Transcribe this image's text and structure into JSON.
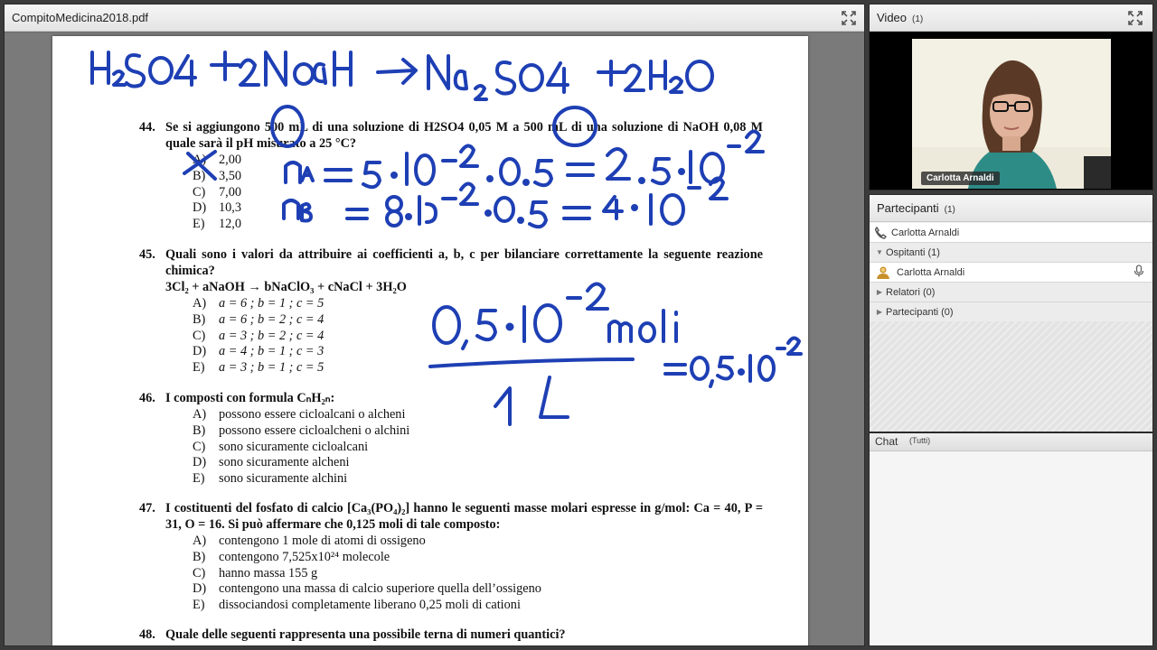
{
  "document_pod": {
    "title": "CompitoMedicina2018.pdf",
    "questions": [
      {
        "num": "44.",
        "text": "Se si aggiungono 500 mL di una soluzione di H2SO4 0,05 M a 500 mL di una soluzione di NaOH 0,08 M quale sarà il pH misurato a 25 °C?",
        "options": [
          {
            "letter": "A)",
            "text": "2,00"
          },
          {
            "letter": "B)",
            "text": "3,50"
          },
          {
            "letter": "C)",
            "text": "7,00"
          },
          {
            "letter": "D)",
            "text": "10,3"
          },
          {
            "letter": "E)",
            "text": "12,0"
          }
        ]
      },
      {
        "num": "45.",
        "text": "Quali sono i valori da attribuire ai coefficienti a, b, c per bilanciare correttamente la seguente reazione chimica?",
        "formula": "3Cl₂ + aNaOH → bNaClO₃ + cNaCl + 3H₂O",
        "options": [
          {
            "letter": "A)",
            "text": "a = 6 ; b = 1 ; c = 5"
          },
          {
            "letter": "B)",
            "text": "a = 6 ; b = 2 ; c = 4"
          },
          {
            "letter": "C)",
            "text": "a = 3 ; b = 2 ; c = 4"
          },
          {
            "letter": "D)",
            "text": "a = 4 ; b = 1 ; c = 3"
          },
          {
            "letter": "E)",
            "text": "a = 3 ; b = 1 ; c = 5"
          }
        ]
      },
      {
        "num": "46.",
        "text": "I composti con formula CₙH₂ₙ:",
        "options": [
          {
            "letter": "A)",
            "text": "possono essere cicloalcani o alcheni"
          },
          {
            "letter": "B)",
            "text": "possono essere cicloalcheni o alchini"
          },
          {
            "letter": "C)",
            "text": "sono sicuramente cicloalcani"
          },
          {
            "letter": "D)",
            "text": "sono sicuramente alcheni"
          },
          {
            "letter": "E)",
            "text": "sono sicuramente alchini"
          }
        ]
      },
      {
        "num": "47.",
        "text": "I costituenti del fosfato di calcio [Ca₃(PO₄)₂] hanno le seguenti masse molari espresse in g/mol: Ca = 40, P = 31, O = 16. Si può affermare che 0,125 moli di tale composto:",
        "options": [
          {
            "letter": "A)",
            "text": "contengono 1 mole di atomi di ossigeno"
          },
          {
            "letter": "B)",
            "text": "contengono 7,525x10²⁴ molecole"
          },
          {
            "letter": "C)",
            "text": "hanno massa 155 g"
          },
          {
            "letter": "D)",
            "text": "contengono una massa di calcio superiore quella dell’ossigeno"
          },
          {
            "letter": "E)",
            "text": "dissociandosi completamente liberano 0,25 moli di cationi"
          }
        ]
      },
      {
        "num": "48.",
        "text": "Quale delle seguenti rappresenta una possibile terna di numeri quantici?",
        "options": []
      }
    ],
    "ink_color": "#1e3fb4"
  },
  "video_pod": {
    "title": "Video",
    "count": "(1)",
    "presenter_name": "Carlotta Arnaldi"
  },
  "participants_pod": {
    "title": "Partecipanti",
    "count": "(1)",
    "host_name": "Carlotta Arnaldi",
    "groups": [
      {
        "label": "Ospitanti (1)",
        "expanded": true
      },
      {
        "label": "Relatori (0)",
        "expanded": false
      },
      {
        "label": "Partecipanti (0)",
        "expanded": false
      }
    ],
    "host_row_name": "Carlotta Arnaldi"
  },
  "chat_pod": {
    "title": "Chat",
    "scope": "(Tutti)"
  }
}
